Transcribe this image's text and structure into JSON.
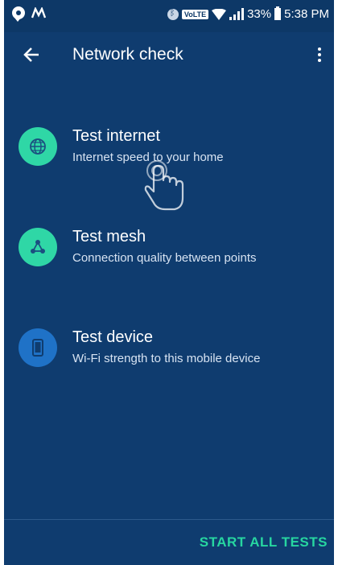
{
  "status_bar": {
    "volte": "VoLTE",
    "battery_percent": "33%",
    "time": "5:38 PM"
  },
  "app_bar": {
    "title": "Network check"
  },
  "tests": [
    {
      "title": "Test internet",
      "subtitle": "Internet speed to your home",
      "icon": "globe-icon",
      "icon_bg": "#2fd7a6"
    },
    {
      "title": "Test mesh",
      "subtitle": "Connection quality between points",
      "icon": "mesh-icon",
      "icon_bg": "#2fd7a6"
    },
    {
      "title": "Test device",
      "subtitle": "Wi-Fi strength to this mobile device",
      "icon": "phone-icon",
      "icon_bg": "#1f72c7"
    }
  ],
  "footer": {
    "start_all_label": "START ALL TESTS",
    "accent": "#27d6a0"
  }
}
